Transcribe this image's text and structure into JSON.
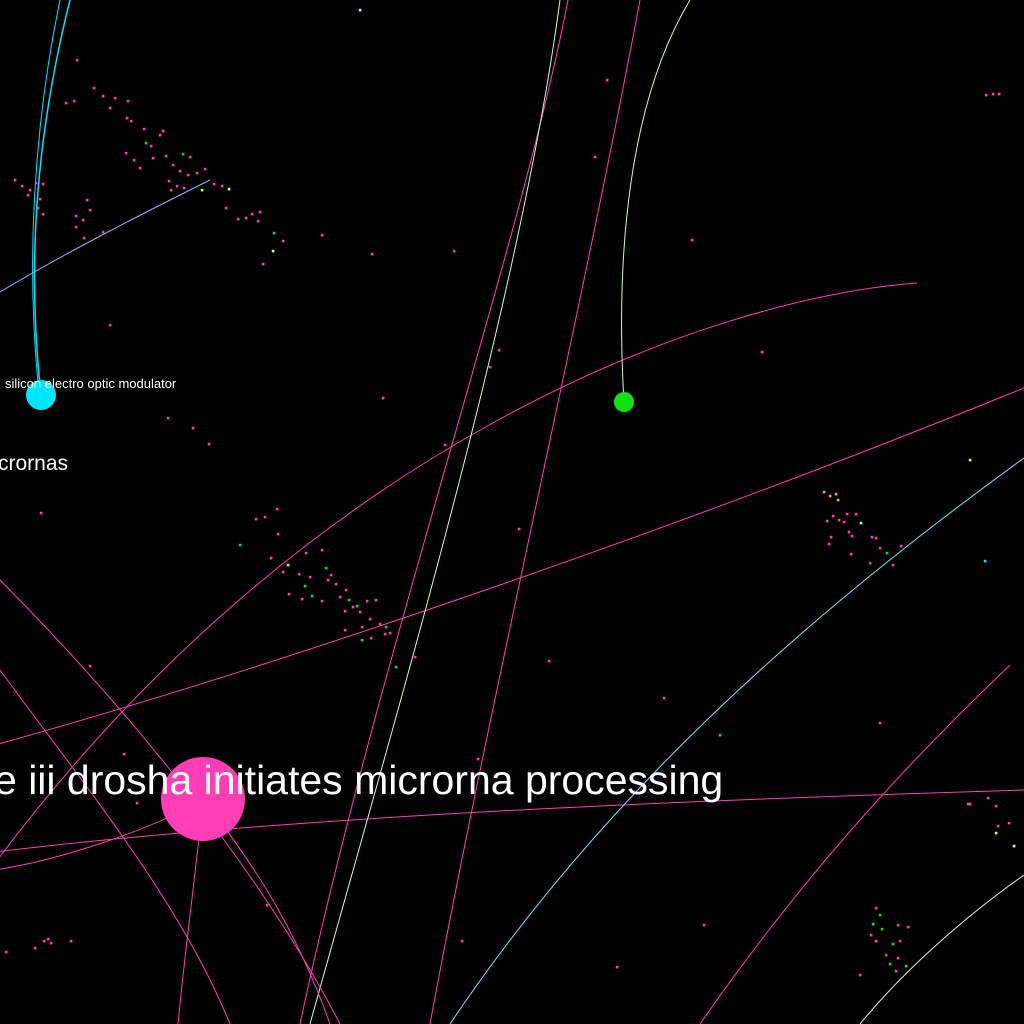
{
  "graph": {
    "background": "#000000",
    "node_colors": {
      "magenta": "#ff3eb5",
      "cyan": "#00e5ff",
      "green": "#12e012",
      "yellow": "#e6ff3c",
      "orange": "#ff9c5a"
    },
    "labels": {
      "drosha": "e iii drosha initiates microrna processing",
      "micrornas": "crornas",
      "modulator": "silicon electro optic modulator"
    }
  }
}
